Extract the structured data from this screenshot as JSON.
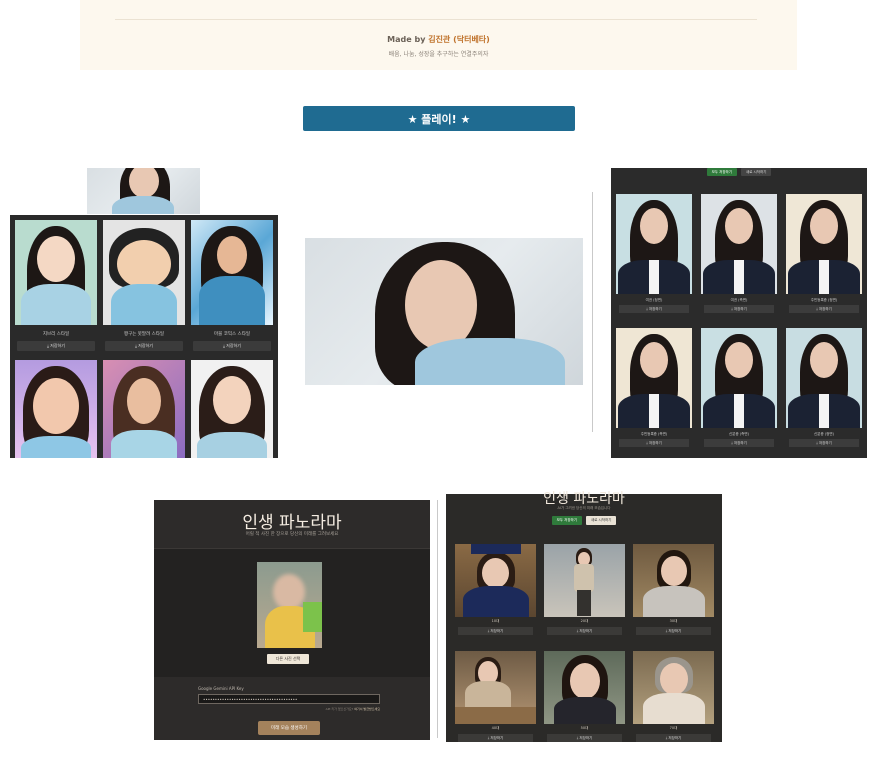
{
  "footer": {
    "made_by_prefix": "Made by ",
    "author": "김진관 (닥터베타)",
    "subtitle": "배움, 나눔, 성장을 추구하는 연결주의자"
  },
  "play_button": {
    "label": "★ 플레이! ★"
  },
  "styles_panel": {
    "cards": [
      {
        "label": "지브리 스타일",
        "save": "⤓ 저장하기"
      },
      {
        "label": "짱구는 못말려 스타일",
        "save": "⤓ 저장하기"
      },
      {
        "label": "마블 코믹스 스타일",
        "save": "⤓ 저장하기"
      },
      {
        "label": "",
        "save": ""
      },
      {
        "label": "",
        "save": ""
      },
      {
        "label": "",
        "save": ""
      }
    ]
  },
  "id_panel": {
    "tabs": [
      {
        "label": "모두 저장하기",
        "active": true
      },
      {
        "label": "새로 시작하기",
        "active": false
      }
    ],
    "cards": [
      {
        "label": "여권 (정면)",
        "save": "⤓ 저장하기"
      },
      {
        "label": "여권 (측면)",
        "save": "⤓ 저장하기"
      },
      {
        "label": "주민등록증 (정면)",
        "save": "⤓ 저장하기"
      },
      {
        "label": "주민등록증 (측면)",
        "save": "⤓ 저장하기"
      },
      {
        "label": "신분증 (측면)",
        "save": "⤓ 저장하기"
      },
      {
        "label": "신분증 (정면)",
        "save": "⤓ 저장하기"
      }
    ]
  },
  "panorama_input": {
    "title": "인생 파노라마",
    "subtitle": "어릴 적 사진 한 장으로 당신의 미래를 그려보세요",
    "change_photo": "다른 사진 선택",
    "api_label": "Google Gemini API Key",
    "api_value": "••••••••••••••••••••••••••••••••••••••••",
    "api_hint": "API 키가 없으신가요?",
    "api_hint_link": "여기서 발급받으세요",
    "generate": "미래 모습 생성하기"
  },
  "panorama_results": {
    "title": "인생 파노라마",
    "subtitle": "AI가 그려낸 당신의 미래 모습입니다",
    "tabs": [
      {
        "label": "모두 저장하기",
        "active": true
      },
      {
        "label": "새로 시작하기",
        "active": false
      }
    ],
    "cards": [
      {
        "label": "10대",
        "save": "⤓ 저장하기"
      },
      {
        "label": "20대",
        "save": "⤓ 저장하기"
      },
      {
        "label": "30대",
        "save": "⤓ 저장하기"
      },
      {
        "label": "40대",
        "save": "⤓ 저장하기"
      },
      {
        "label": "50대",
        "save": "⤓ 저장하기"
      },
      {
        "label": "70대",
        "save": "⤓ 저장하기"
      }
    ]
  },
  "colors": {
    "accent_blue": "#1f6b91",
    "author_orange": "#c0732c",
    "save_all_green": "#2f7a3b",
    "generate_brown": "#a4825c"
  }
}
